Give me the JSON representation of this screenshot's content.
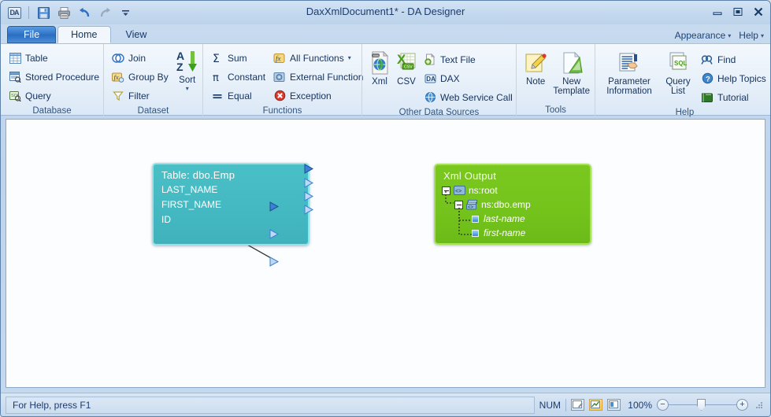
{
  "window": {
    "title": "DaxXmlDocument1* -  DA Designer",
    "app_icon_text": "DA",
    "minimize": "minimize-icon",
    "maximize": "maximize-icon",
    "close": "close-icon"
  },
  "quick_access": [
    {
      "name": "save-icon",
      "label": "Save"
    },
    {
      "name": "print-icon",
      "label": "Print"
    },
    {
      "name": "undo-icon",
      "label": "Undo"
    },
    {
      "name": "redo-icon",
      "label": "Redo"
    },
    {
      "name": "customize-qat-icon",
      "label": "Customize Quick Access Toolbar"
    }
  ],
  "tabs": [
    {
      "label": "File",
      "state": "file"
    },
    {
      "label": "Home",
      "state": "active"
    },
    {
      "label": "View",
      "state": "normal"
    }
  ],
  "top_right": [
    {
      "label": "Appearance"
    },
    {
      "label": "Help"
    }
  ],
  "ribbon": {
    "groups": [
      {
        "label": "Database",
        "items": [
          {
            "label": "Table",
            "icon": "table-icon"
          },
          {
            "label": "Stored Procedure",
            "icon": "stored-procedure-icon"
          },
          {
            "label": "Query",
            "icon": "query-icon"
          }
        ]
      },
      {
        "label": "Dataset",
        "items": [
          {
            "label": "Join",
            "icon": "join-icon"
          },
          {
            "label": "Group By",
            "icon": "group-by-icon"
          },
          {
            "label": "Filter",
            "icon": "filter-icon"
          }
        ],
        "big_items": [
          {
            "label": "Sort",
            "icon": "sort-az-icon",
            "has_dropdown": true
          }
        ]
      },
      {
        "label": "Functions",
        "items": [
          {
            "label": "Sum",
            "icon": "sigma-icon"
          },
          {
            "label": "Constant",
            "icon": "pi-icon"
          },
          {
            "label": "Equal",
            "icon": "equals-icon"
          }
        ],
        "items2": [
          {
            "label": "All Functions",
            "icon": "fx-icon",
            "has_dropdown": true
          },
          {
            "label": "External Function",
            "icon": "external-function-icon"
          },
          {
            "label": "Exception",
            "icon": "exception-icon"
          }
        ]
      },
      {
        "label": "Other Data Sources",
        "big_items": [
          {
            "label": "Xml",
            "icon": "xml-file-icon"
          },
          {
            "label": "CSV",
            "icon": "csv-file-icon"
          }
        ],
        "items": [
          {
            "label": "Text File",
            "icon": "text-file-icon"
          },
          {
            "label": "DAX",
            "icon": "dax-icon"
          },
          {
            "label": "Web Service Call",
            "icon": "web-service-icon"
          }
        ]
      },
      {
        "label": "Tools",
        "big_items": [
          {
            "label": "Note",
            "icon": "note-icon"
          },
          {
            "label": "New Template",
            "icon": "new-template-icon"
          }
        ]
      },
      {
        "label": "Help",
        "big_items": [
          {
            "label": "Parameter Information",
            "icon": "parameter-information-icon"
          },
          {
            "label": "Query List",
            "icon": "query-list-icon"
          }
        ],
        "items": [
          {
            "label": "Find",
            "icon": "find-icon"
          },
          {
            "label": "Help Topics",
            "icon": "help-topics-icon"
          },
          {
            "label": "Tutorial",
            "icon": "tutorial-icon"
          }
        ]
      }
    ]
  },
  "canvas": {
    "table_node": {
      "title": "Table: dbo.Emp",
      "fields": [
        "LAST_NAME",
        "FIRST_NAME",
        "ID"
      ],
      "color": "#45b9c2"
    },
    "xml_node": {
      "title": "Xml Output",
      "color": "#74c31c",
      "tree": [
        {
          "label": "ns:root",
          "level": 0,
          "icon": "xml-element-icon",
          "expander": "minus"
        },
        {
          "label": "ns:dbo.emp",
          "level": 1,
          "icon": "xml-repeat-element-icon",
          "expander": "minus"
        },
        {
          "label": "last-name",
          "level": 2,
          "icon": "xml-attribute-icon",
          "italic": true
        },
        {
          "label": "first-name",
          "level": 2,
          "icon": "xml-attribute-icon",
          "italic": true
        }
      ]
    },
    "connections": 3
  },
  "statusbar": {
    "message": "For Help, press F1",
    "num_indicator": "NUM",
    "view_icons": [
      {
        "name": "edit-view-icon",
        "selected": false
      },
      {
        "name": "design-view-icon",
        "selected": true
      },
      {
        "name": "preview-view-icon",
        "selected": false
      }
    ],
    "zoom_percent": "100%",
    "zoom_out": "−",
    "zoom_in": "+"
  }
}
